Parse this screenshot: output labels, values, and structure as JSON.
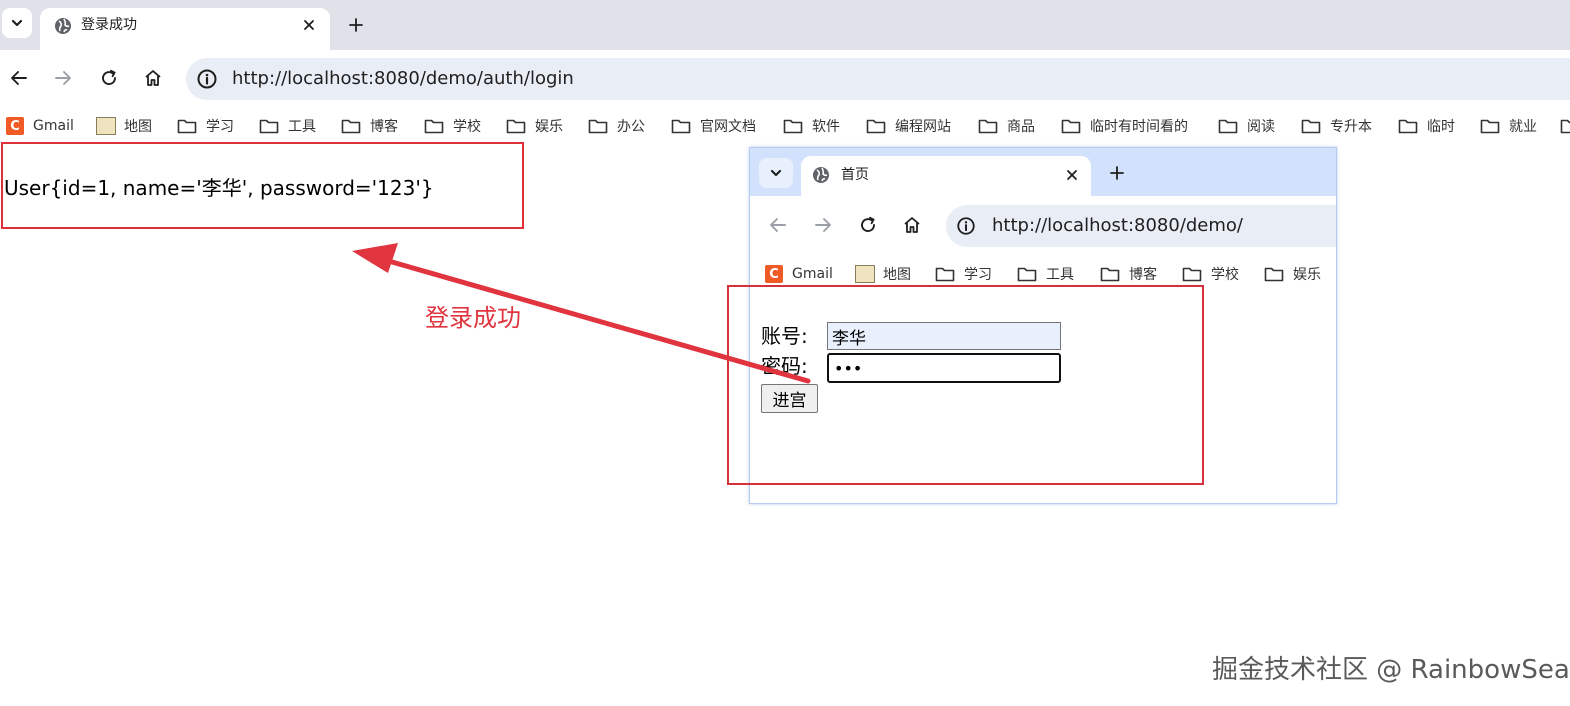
{
  "browser": {
    "tab_title": "登录成功",
    "url": "http://localhost:8080/demo/auth/login",
    "bookmarks": [
      "Gmail",
      "地图",
      "学习",
      "工具",
      "博客",
      "学校",
      "娱乐",
      "办公",
      "官网文档",
      "软件",
      "编程网站",
      "商品",
      "临时有时间看的",
      "阅读",
      "专升本",
      "临时",
      "就业"
    ]
  },
  "page": {
    "result_text": "User{id=1, name='李华', password='123'}"
  },
  "annotation": {
    "text": "登录成功",
    "color": "#e0343e"
  },
  "inset_browser": {
    "tab_title": "首页",
    "url": "http://localhost:8080/demo/",
    "bookmarks": [
      "Gmail",
      "地图",
      "学习",
      "工具",
      "博客",
      "学校",
      "娱乐"
    ],
    "form": {
      "account_label": "账号:",
      "account_value": "李华",
      "password_label": "密码:",
      "password_value": "123",
      "submit_label": "进宫"
    }
  },
  "watermark": "掘金技术社区 @ RainbowSea"
}
